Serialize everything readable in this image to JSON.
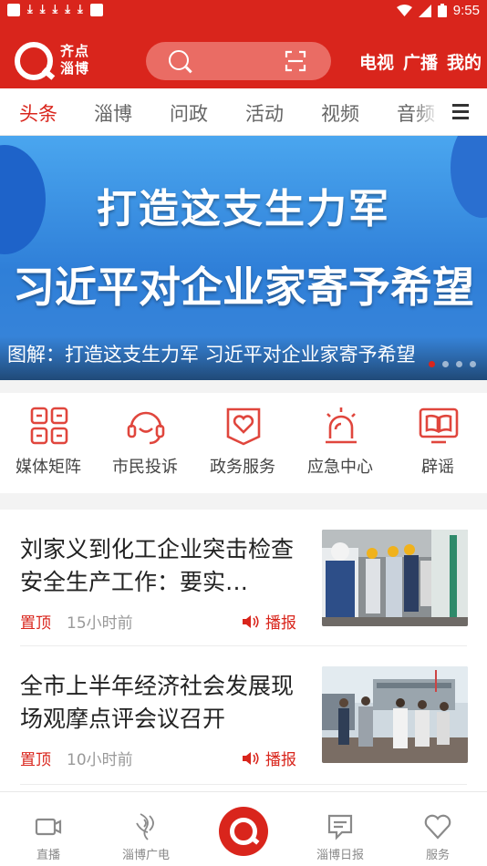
{
  "status_bar": {
    "time": "9:55",
    "notification_icons": [
      "app-icon",
      "download-icon",
      "download-icon",
      "download-icon",
      "download-icon",
      "download-icon",
      "image-icon"
    ],
    "right_icons": [
      "wifi-icon",
      "signal-icon",
      "battery-icon"
    ]
  },
  "header": {
    "logo_line1": "齐点",
    "logo_line2": "淄博",
    "search_icon": "search-icon",
    "scan_icon": "scan-icon",
    "links": [
      "电视",
      "广播",
      "我的"
    ]
  },
  "tabs": {
    "items": [
      "头条",
      "淄博",
      "问政",
      "活动",
      "视频",
      "音频"
    ],
    "active": "头条",
    "menu_icon": "menu-icon"
  },
  "banner": {
    "headline_line1": "打造这支生力军",
    "headline_line2": "习近平对企业家寄予希望",
    "caption": "图解：打造这支生力军 习近平对企业家寄予希望",
    "slide_count": 4,
    "active_slide": 1
  },
  "quick_entries": [
    {
      "label": "媒体矩阵",
      "icon": "matrix-icon"
    },
    {
      "label": "市民投诉",
      "icon": "headset-icon"
    },
    {
      "label": "政务服务",
      "icon": "heart-doc-icon"
    },
    {
      "label": "应急中心",
      "icon": "alarm-light-icon"
    },
    {
      "label": "辟谣",
      "icon": "book-icon"
    }
  ],
  "news": [
    {
      "title": "刘家义到化工企业突击检查安全生产工作：要实…",
      "pin": "置顶",
      "time": "15小时前",
      "play_label": "播报"
    },
    {
      "title": "全市上半年经济社会发展现场观摩点评会议召开",
      "pin": "置顶",
      "time": "10小时前",
      "play_label": "播报"
    }
  ],
  "bottom_nav": [
    {
      "label": "直播",
      "icon": "video-camera-icon"
    },
    {
      "label": "淄博广电",
      "icon": "zibo-broadcast-icon"
    },
    {
      "label": "",
      "icon": "home-logo-icon"
    },
    {
      "label": "淄博日报",
      "icon": "newspaper-icon"
    },
    {
      "label": "服务",
      "icon": "heart-icon"
    }
  ],
  "colors": {
    "brand_red": "#d9251c",
    "search_bg": "#ea6c64",
    "banner_blue": "#2f7fd8"
  }
}
